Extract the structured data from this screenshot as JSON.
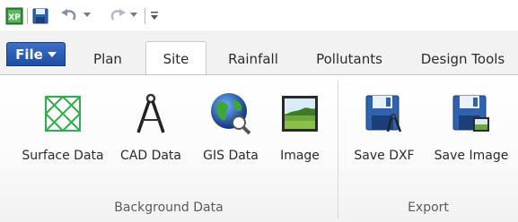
{
  "tabs": [
    {
      "label": "File"
    },
    {
      "label": "Plan"
    },
    {
      "label": "Site",
      "active": true
    },
    {
      "label": "Rainfall"
    },
    {
      "label": "Pollutants"
    },
    {
      "label": "Design Tools"
    }
  ],
  "groups": {
    "background": {
      "label": "Background Data",
      "buttons": [
        "Surface Data",
        "CAD Data",
        "GIS Data",
        "Image"
      ]
    },
    "export": {
      "label": "Export",
      "buttons": [
        "Save DXF",
        "Save Image"
      ]
    }
  },
  "qat": {
    "icons": [
      "app-icon",
      "save-icon",
      "undo-icon",
      "redo-icon",
      "customize-icon"
    ]
  },
  "colors": {
    "file_tab": "#2a5cb8",
    "accent_green": "#2eae4c",
    "floppy_blue": "#2f63b0"
  }
}
